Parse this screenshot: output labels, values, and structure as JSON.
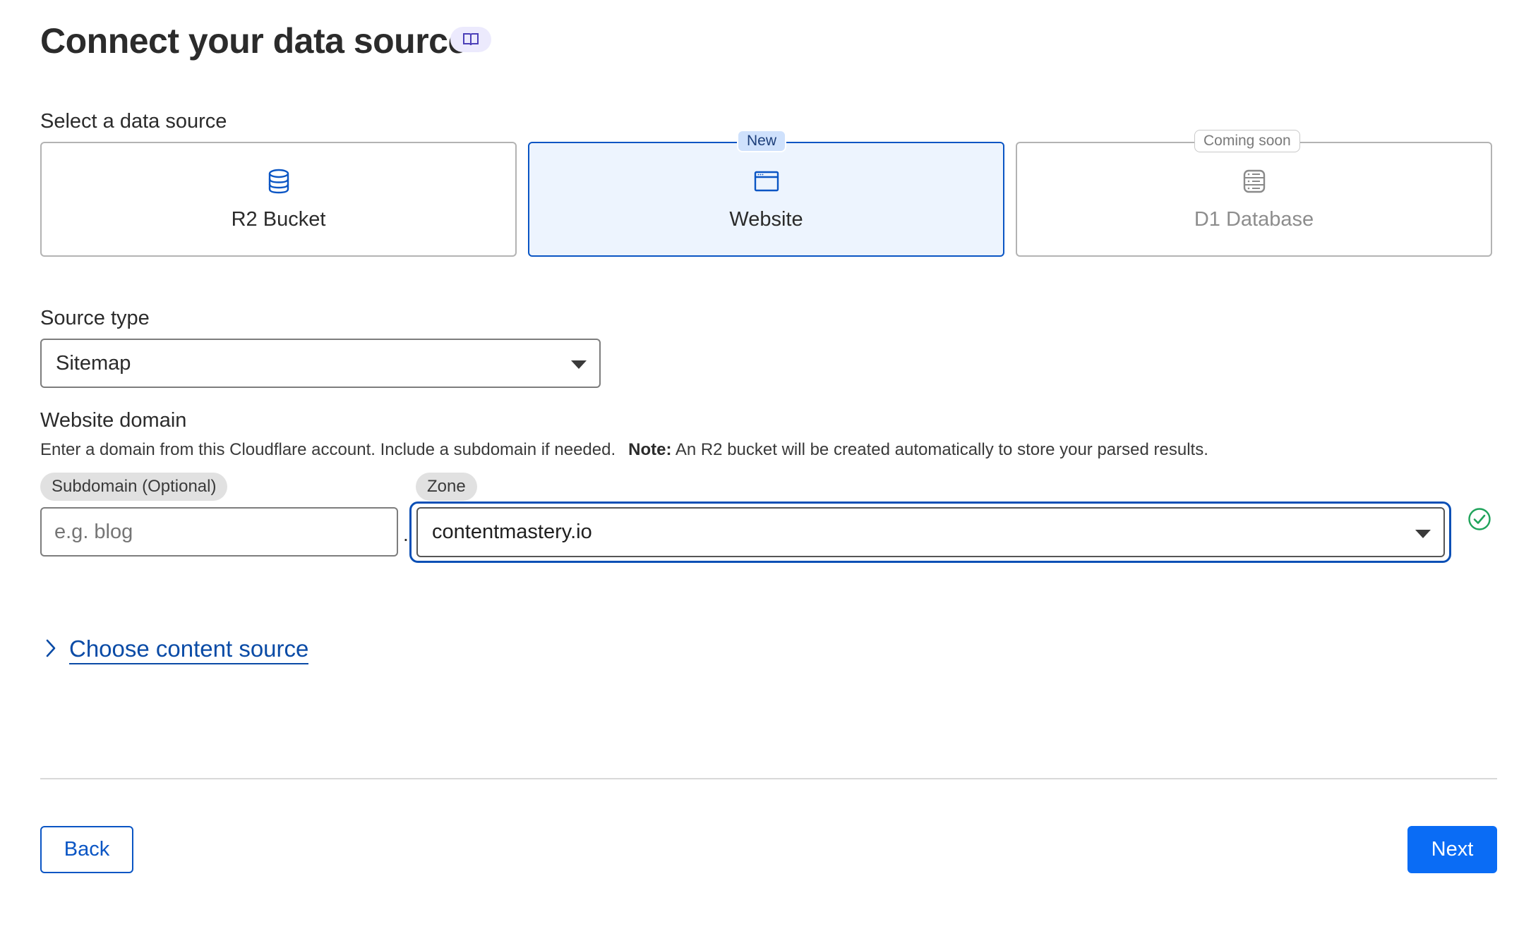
{
  "page": {
    "title": "Connect your data source",
    "doc_icon": "book-icon"
  },
  "data_source": {
    "label": "Select a data source",
    "options": [
      {
        "label": "R2 Bucket",
        "icon": "database-icon",
        "selected": false,
        "disabled": false,
        "badge": ""
      },
      {
        "label": "Website",
        "icon": "browser-window-icon",
        "selected": true,
        "disabled": false,
        "badge": "New"
      },
      {
        "label": "D1 Database",
        "icon": "d1-database-icon",
        "selected": false,
        "disabled": true,
        "badge": "Coming soon"
      }
    ]
  },
  "source_type": {
    "label": "Source type",
    "value": "Sitemap"
  },
  "website_domain": {
    "label": "Website domain",
    "helper": "Enter a domain from this Cloudflare account. Include a subdomain if needed.",
    "note_label": "Note:",
    "note_text": "An R2 bucket will be created automatically to store your parsed results.",
    "subdomain": {
      "label": "Subdomain (Optional)",
      "placeholder": "e.g. blog",
      "value": ""
    },
    "separator": ".",
    "zone": {
      "label": "Zone",
      "value": "contentmastery.io",
      "status_icon": "check-circle-icon"
    }
  },
  "content_source": {
    "label": "Choose content source",
    "icon": "chevron-right-icon"
  },
  "footer": {
    "back_label": "Back",
    "next_label": "Next"
  },
  "colors": {
    "accent": "#0a55c4",
    "primary_button": "#0a6cf5",
    "selected_card_bg": "#edf4fe",
    "success": "#1fa35b"
  }
}
